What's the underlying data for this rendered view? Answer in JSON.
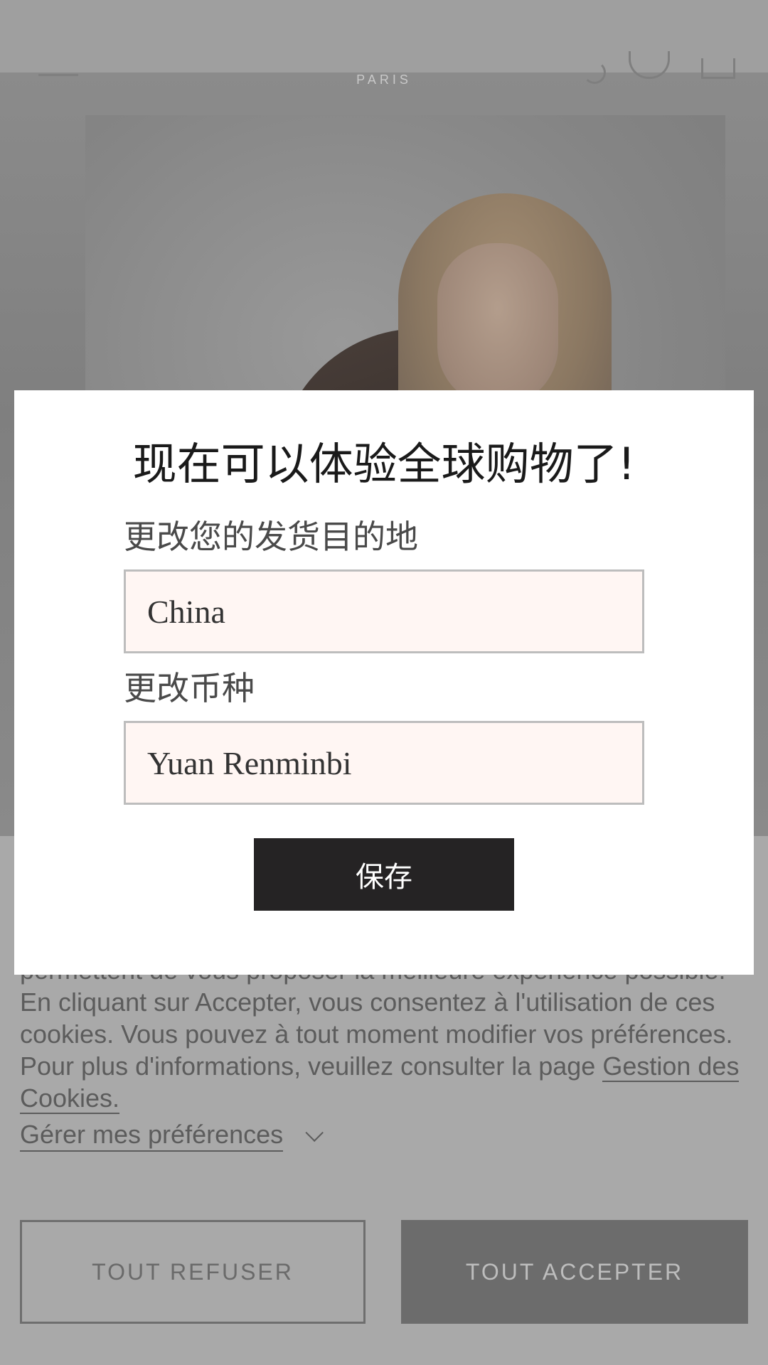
{
  "header": {
    "brand_subtitle": "PARIS",
    "icons": [
      "menu-icon",
      "search-icon",
      "account-icon",
      "bag-icon"
    ]
  },
  "hero": {
    "image": "woman-portrait"
  },
  "cookie_banner": {
    "text_visible": "permettent de vous proposer la meilleure expérience possible. En cliquant sur Accepter, vous consentez à l'utilisation de ces cookies. Vous pouvez à tout moment modifier vos préférences. Pour plus d'informations, veuillez consulter la page",
    "link_label": "Gestion des Cookies.",
    "preferences_label": "Gérer mes préférences",
    "refuse_label": "TOUT REFUSER",
    "accept_label": "TOUT ACCEPTER"
  },
  "modal": {
    "title": "现在可以体验全球购物了!",
    "destination_label": "更改您的发货目的地",
    "destination_value": "China",
    "currency_label": "更改币种",
    "currency_value": "Yuan Renminbi",
    "save_label": "保存"
  },
  "colors": {
    "overlay": "#9e9e9e",
    "modal_bg": "#ffffff",
    "field_bg": "#fff6f3",
    "save_bg": "#252324",
    "accept_bg": "#6c6c6c"
  }
}
